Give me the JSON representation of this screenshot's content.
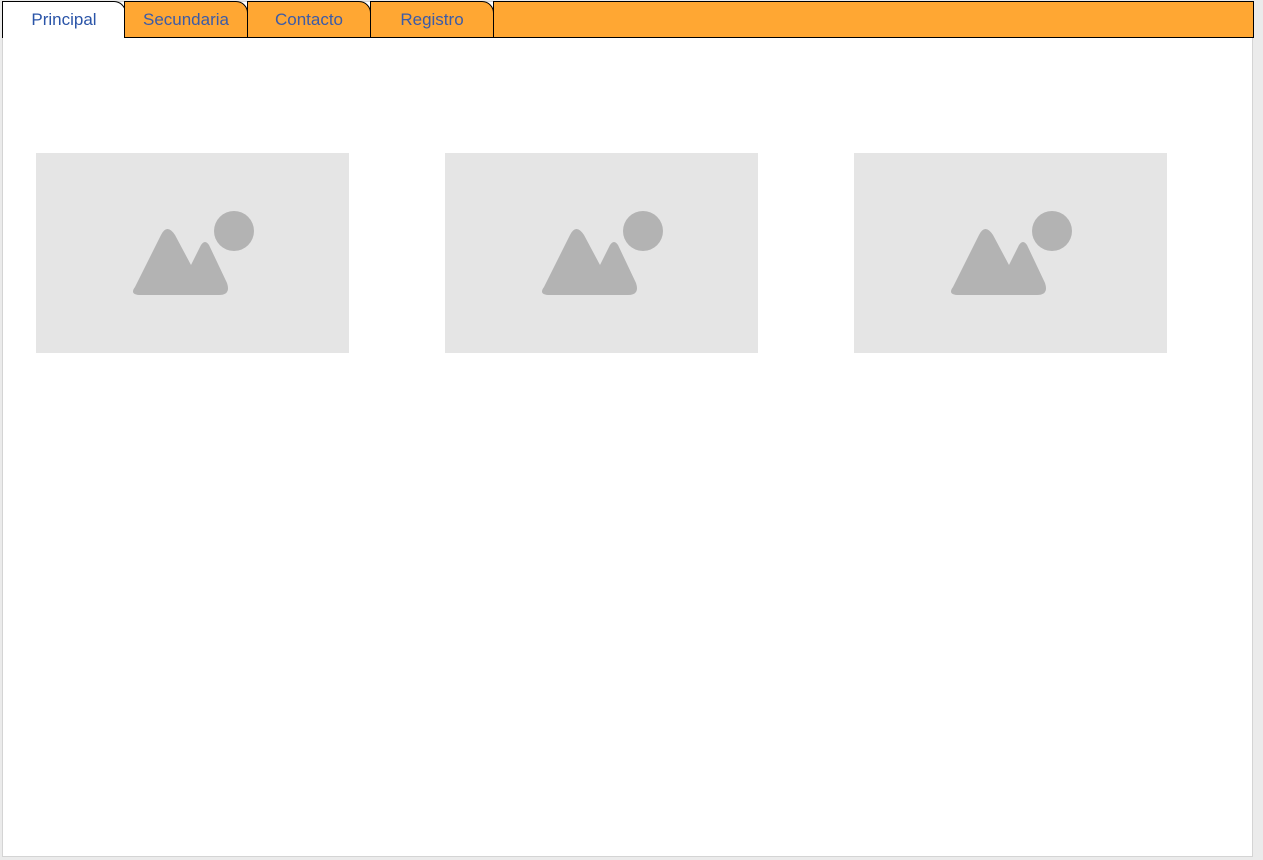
{
  "tabs": [
    {
      "label": "Principal",
      "active": true
    },
    {
      "label": "Secundaria",
      "active": false
    },
    {
      "label": "Contacto",
      "active": false
    },
    {
      "label": "Registro",
      "active": false
    }
  ],
  "placeholders": [
    {
      "icon": "image-placeholder-icon"
    },
    {
      "icon": "image-placeholder-icon"
    },
    {
      "icon": "image-placeholder-icon"
    }
  ],
  "colors": {
    "tab_background": "#ffa733",
    "active_tab_background": "#ffffff",
    "tab_text": "#3b5ba8",
    "placeholder_background": "#e5e5e5",
    "placeholder_icon": "#b3b3b3"
  }
}
